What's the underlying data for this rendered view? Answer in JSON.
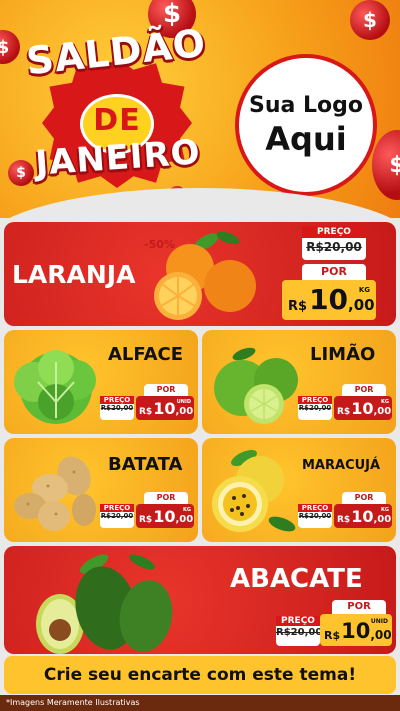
{
  "header": {
    "seal_line1": "SALDÃO",
    "seal_line2": "DE",
    "seal_line3": "JANEIRO",
    "logo_line1": "Sua Logo",
    "logo_line2": "Aqui",
    "coin_symbol": "$"
  },
  "products": [
    {
      "name": "LARANJA",
      "discount": "-50%",
      "old_label": "PREÇO",
      "old_price": "R$20,00",
      "new_label": "POR",
      "currency": "R$",
      "price_int": "10",
      "price_dec": ",00",
      "unit": "KG"
    },
    {
      "name": "ALFACE",
      "old_label": "PREÇO",
      "old_price": "R$20,00",
      "new_label": "POR",
      "currency": "R$",
      "price_int": "10",
      "price_dec": ",00",
      "unit": "UNID"
    },
    {
      "name": "LIMÃO",
      "old_label": "PREÇO",
      "old_price": "R$20,00",
      "new_label": "POR",
      "currency": "R$",
      "price_int": "10",
      "price_dec": ",00",
      "unit": "KG"
    },
    {
      "name": "BATATA",
      "old_label": "PREÇO",
      "old_price": "R$20,00",
      "new_label": "POR",
      "currency": "R$",
      "price_int": "10",
      "price_dec": ",00",
      "unit": "KG"
    },
    {
      "name": "MARACUJÁ",
      "old_label": "PREÇO",
      "old_price": "R$20,00",
      "new_label": "POR",
      "currency": "R$",
      "price_int": "10",
      "price_dec": ",00",
      "unit": "KG"
    },
    {
      "name": "ABACATE",
      "old_label": "PREÇO",
      "old_price": "R$20,00",
      "new_label": "POR",
      "currency": "R$",
      "price_int": "10",
      "price_dec": ",00",
      "unit": "UNID"
    }
  ],
  "footer": {
    "cta": "Crie seu encarte com este tema!",
    "disclaimer": "*Imagens Meramente Ilustrativas"
  },
  "colors": {
    "red": "#c61a1a",
    "yellow": "#ffc42d",
    "orange": "#f7a21a"
  }
}
